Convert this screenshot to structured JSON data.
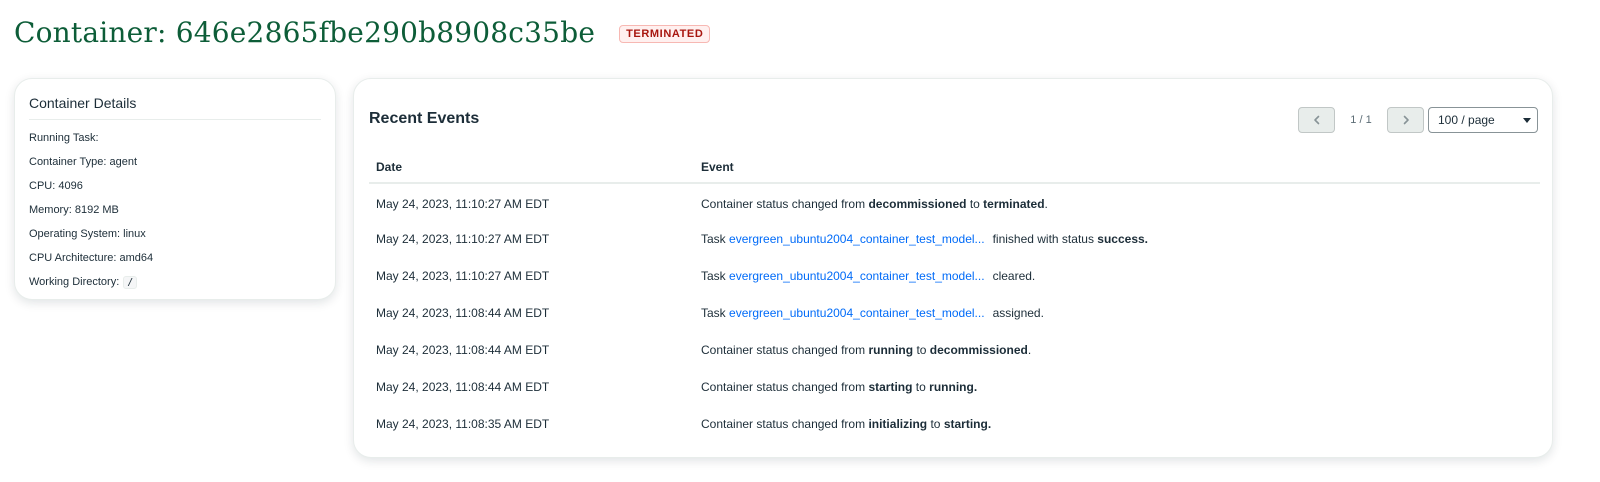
{
  "header": {
    "title": "Container: 646e2865fbe290b8908c35be",
    "status": "TERMINATED"
  },
  "details": {
    "title": "Container Details",
    "running_task": {
      "label": "Running Task:"
    },
    "container_type": {
      "label": "Container Type:",
      "value": "agent"
    },
    "cpu": {
      "label": "CPU:",
      "value": "4096"
    },
    "memory": {
      "label": "Memory:",
      "value": "8192 MB"
    },
    "os": {
      "label": "Operating System:",
      "value": "linux"
    },
    "arch": {
      "label": "CPU Architecture:",
      "value": "amd64"
    },
    "working_dir": {
      "label": "Working Directory:",
      "value": "/"
    }
  },
  "events": {
    "title": "Recent Events",
    "pagination": {
      "page": "1 / 1",
      "page_size": "100 / page"
    },
    "columns": {
      "date": "Date",
      "event": "Event"
    },
    "rows": [
      {
        "date": "May 24, 2023, 11:10:27 AM EDT",
        "prefix": "Container status changed from",
        "from": "decommissioned",
        "to_word": "to",
        "to": "terminated",
        "end": "."
      },
      {
        "date": "May 24, 2023, 11:10:27 AM EDT",
        "task_word": "Task",
        "task": "evergreen_ubuntu2004_container_test_model...",
        "suffix": "finished with status",
        "status": "success",
        "end": "."
      },
      {
        "date": "May 24, 2023, 11:10:27 AM EDT",
        "task_word": "Task",
        "task": "evergreen_ubuntu2004_container_test_model...",
        "suffix": "cleared."
      },
      {
        "date": "May 24, 2023, 11:08:44 AM EDT",
        "task_word": "Task",
        "task": "evergreen_ubuntu2004_container_test_model...",
        "suffix": "assigned."
      },
      {
        "date": "May 24, 2023, 11:08:44 AM EDT",
        "prefix": "Container status changed from",
        "from": "running",
        "to_word": "to",
        "to": "decommissioned",
        "end": "."
      },
      {
        "date": "May 24, 2023, 11:08:44 AM EDT",
        "prefix": "Container status changed from",
        "from": "starting",
        "to_word": "to",
        "to": "running",
        "end": "."
      },
      {
        "date": "May 24, 2023, 11:08:35 AM EDT",
        "prefix": "Container status changed from",
        "from": "initializing",
        "to_word": "to",
        "to": "starting",
        "end": "."
      }
    ]
  },
  "colors": {
    "title_green": "#0d5d38",
    "badge_red": "#a8160f",
    "link_blue": "#016bf8"
  },
  "icons": {
    "prev": "chevron-left-icon",
    "next": "chevron-right-icon",
    "select": "caret-down-icon"
  }
}
